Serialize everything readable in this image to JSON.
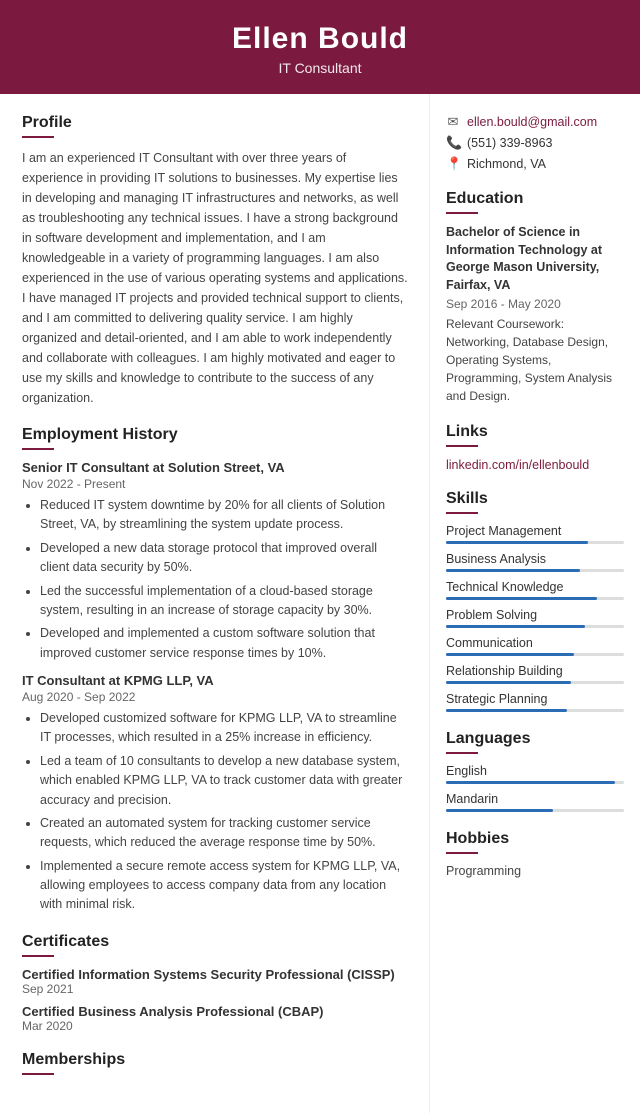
{
  "header": {
    "name": "Ellen Bould",
    "title": "IT Consultant"
  },
  "contact": {
    "email": "ellen.bould@gmail.com",
    "phone": "(551) 339-8963",
    "location": "Richmond, VA"
  },
  "profile": {
    "section_title": "Profile",
    "text": "I am an experienced IT Consultant with over three years of experience in providing IT solutions to businesses. My expertise lies in developing and managing IT infrastructures and networks, as well as troubleshooting any technical issues. I have a strong background in software development and implementation, and I am knowledgeable in a variety of programming languages. I am also experienced in the use of various operating systems and applications. I have managed IT projects and provided technical support to clients, and I am committed to delivering quality service. I am highly organized and detail-oriented, and I am able to work independently and collaborate with colleagues. I am highly motivated and eager to use my skills and knowledge to contribute to the success of any organization."
  },
  "employment": {
    "section_title": "Employment History",
    "jobs": [
      {
        "title": "Senior IT Consultant at Solution Street, VA",
        "dates": "Nov 2022 - Present",
        "bullets": [
          "Reduced IT system downtime by 20% for all clients of Solution Street, VA, by streamlining the system update process.",
          "Developed a new data storage protocol that improved overall client data security by 50%.",
          "Led the successful implementation of a cloud-based storage system, resulting in an increase of storage capacity by 30%.",
          "Developed and implemented a custom software solution that improved customer service response times by 10%."
        ]
      },
      {
        "title": "IT Consultant at KPMG LLP, VA",
        "dates": "Aug 2020 - Sep 2022",
        "bullets": [
          "Developed customized software for KPMG LLP, VA to streamline IT processes, which resulted in a 25% increase in efficiency.",
          "Led a team of 10 consultants to develop a new database system, which enabled KPMG LLP, VA to track customer data with greater accuracy and precision.",
          "Created an automated system for tracking customer service requests, which reduced the average response time by 50%.",
          "Implemented a secure remote access system for KPMG LLP, VA, allowing employees to access company data from any location with minimal risk."
        ]
      }
    ]
  },
  "certificates": {
    "section_title": "Certificates",
    "items": [
      {
        "title": "Certified Information Systems Security Professional (CISSP)",
        "date": "Sep 2021"
      },
      {
        "title": "Certified Business Analysis Professional (CBAP)",
        "date": "Mar 2020"
      }
    ]
  },
  "memberships": {
    "section_title": "Memberships"
  },
  "education": {
    "section_title": "Education",
    "degree": "Bachelor of Science in Information Technology at George Mason University, Fairfax, VA",
    "dates": "Sep 2016 - May 2020",
    "courses": "Relevant Coursework: Networking, Database Design, Operating Systems, Programming, System Analysis and Design."
  },
  "links": {
    "section_title": "Links",
    "items": [
      {
        "label": "linkedin.com/in/ellenbould",
        "url": "https://linkedin.com/in/ellenbould"
      }
    ]
  },
  "skills": {
    "section_title": "Skills",
    "items": [
      {
        "name": "Project Management",
        "level": 80
      },
      {
        "name": "Business Analysis",
        "level": 75
      },
      {
        "name": "Technical Knowledge",
        "level": 85
      },
      {
        "name": "Problem Solving",
        "level": 78
      },
      {
        "name": "Communication",
        "level": 72
      },
      {
        "name": "Relationship Building",
        "level": 70
      },
      {
        "name": "Strategic Planning",
        "level": 68
      }
    ]
  },
  "languages": {
    "section_title": "Languages",
    "items": [
      {
        "name": "English",
        "level": 95
      },
      {
        "name": "Mandarin",
        "level": 60
      }
    ]
  },
  "hobbies": {
    "section_title": "Hobbies",
    "items": [
      {
        "name": "Programming"
      }
    ]
  },
  "icons": {
    "email": "✉",
    "phone": "📞",
    "location": "📍"
  }
}
